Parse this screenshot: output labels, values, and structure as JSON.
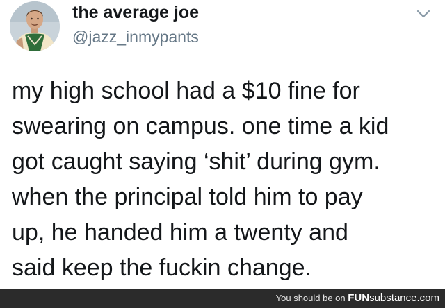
{
  "user": {
    "display_name": "the average joe",
    "handle": "@jazz_inmypants"
  },
  "tweet": {
    "lines": [
      "my high school had a $10 fine for",
      "swearing on campus. one time a kid",
      "got caught saying ‘shit’ during gym.",
      "when the principal told him to pay",
      "up, he handed him a twenty and",
      "said keep the fuckin change."
    ]
  },
  "icons": {
    "avatar": "profile-photo",
    "menu": "chevron-down-icon"
  },
  "footer": {
    "prefix": "You should be on ",
    "brand_fun": "FUN",
    "brand_substance": "substance",
    "domain": ".com"
  },
  "colors": {
    "name": "#14171a",
    "handle": "#657786",
    "footer_bg": "#2b2b2b"
  }
}
